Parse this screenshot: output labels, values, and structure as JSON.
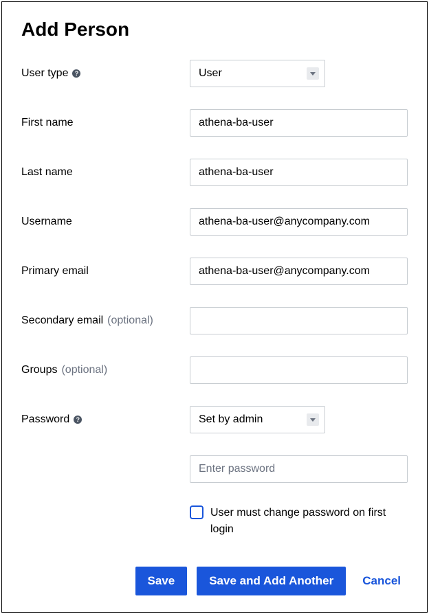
{
  "title": "Add Person",
  "form": {
    "user_type": {
      "label": "User type",
      "value": "User"
    },
    "first_name": {
      "label": "First name",
      "value": "athena-ba-user"
    },
    "last_name": {
      "label": "Last name",
      "value": "athena-ba-user"
    },
    "username": {
      "label": "Username",
      "value": "athena-ba-user@anycompany.com"
    },
    "primary_email": {
      "label": "Primary email",
      "value": "athena-ba-user@anycompany.com"
    },
    "secondary_email": {
      "label": "Secondary email",
      "optional_text": "(optional)",
      "value": ""
    },
    "groups": {
      "label": "Groups",
      "optional_text": "(optional)",
      "value": ""
    },
    "password": {
      "label": "Password",
      "mode_value": "Set by admin",
      "placeholder": "Enter password",
      "value": ""
    },
    "change_password_checkbox": {
      "label": "User must change password on first login",
      "checked": false
    }
  },
  "buttons": {
    "save": "Save",
    "save_add_another": "Save and Add Another",
    "cancel": "Cancel"
  }
}
